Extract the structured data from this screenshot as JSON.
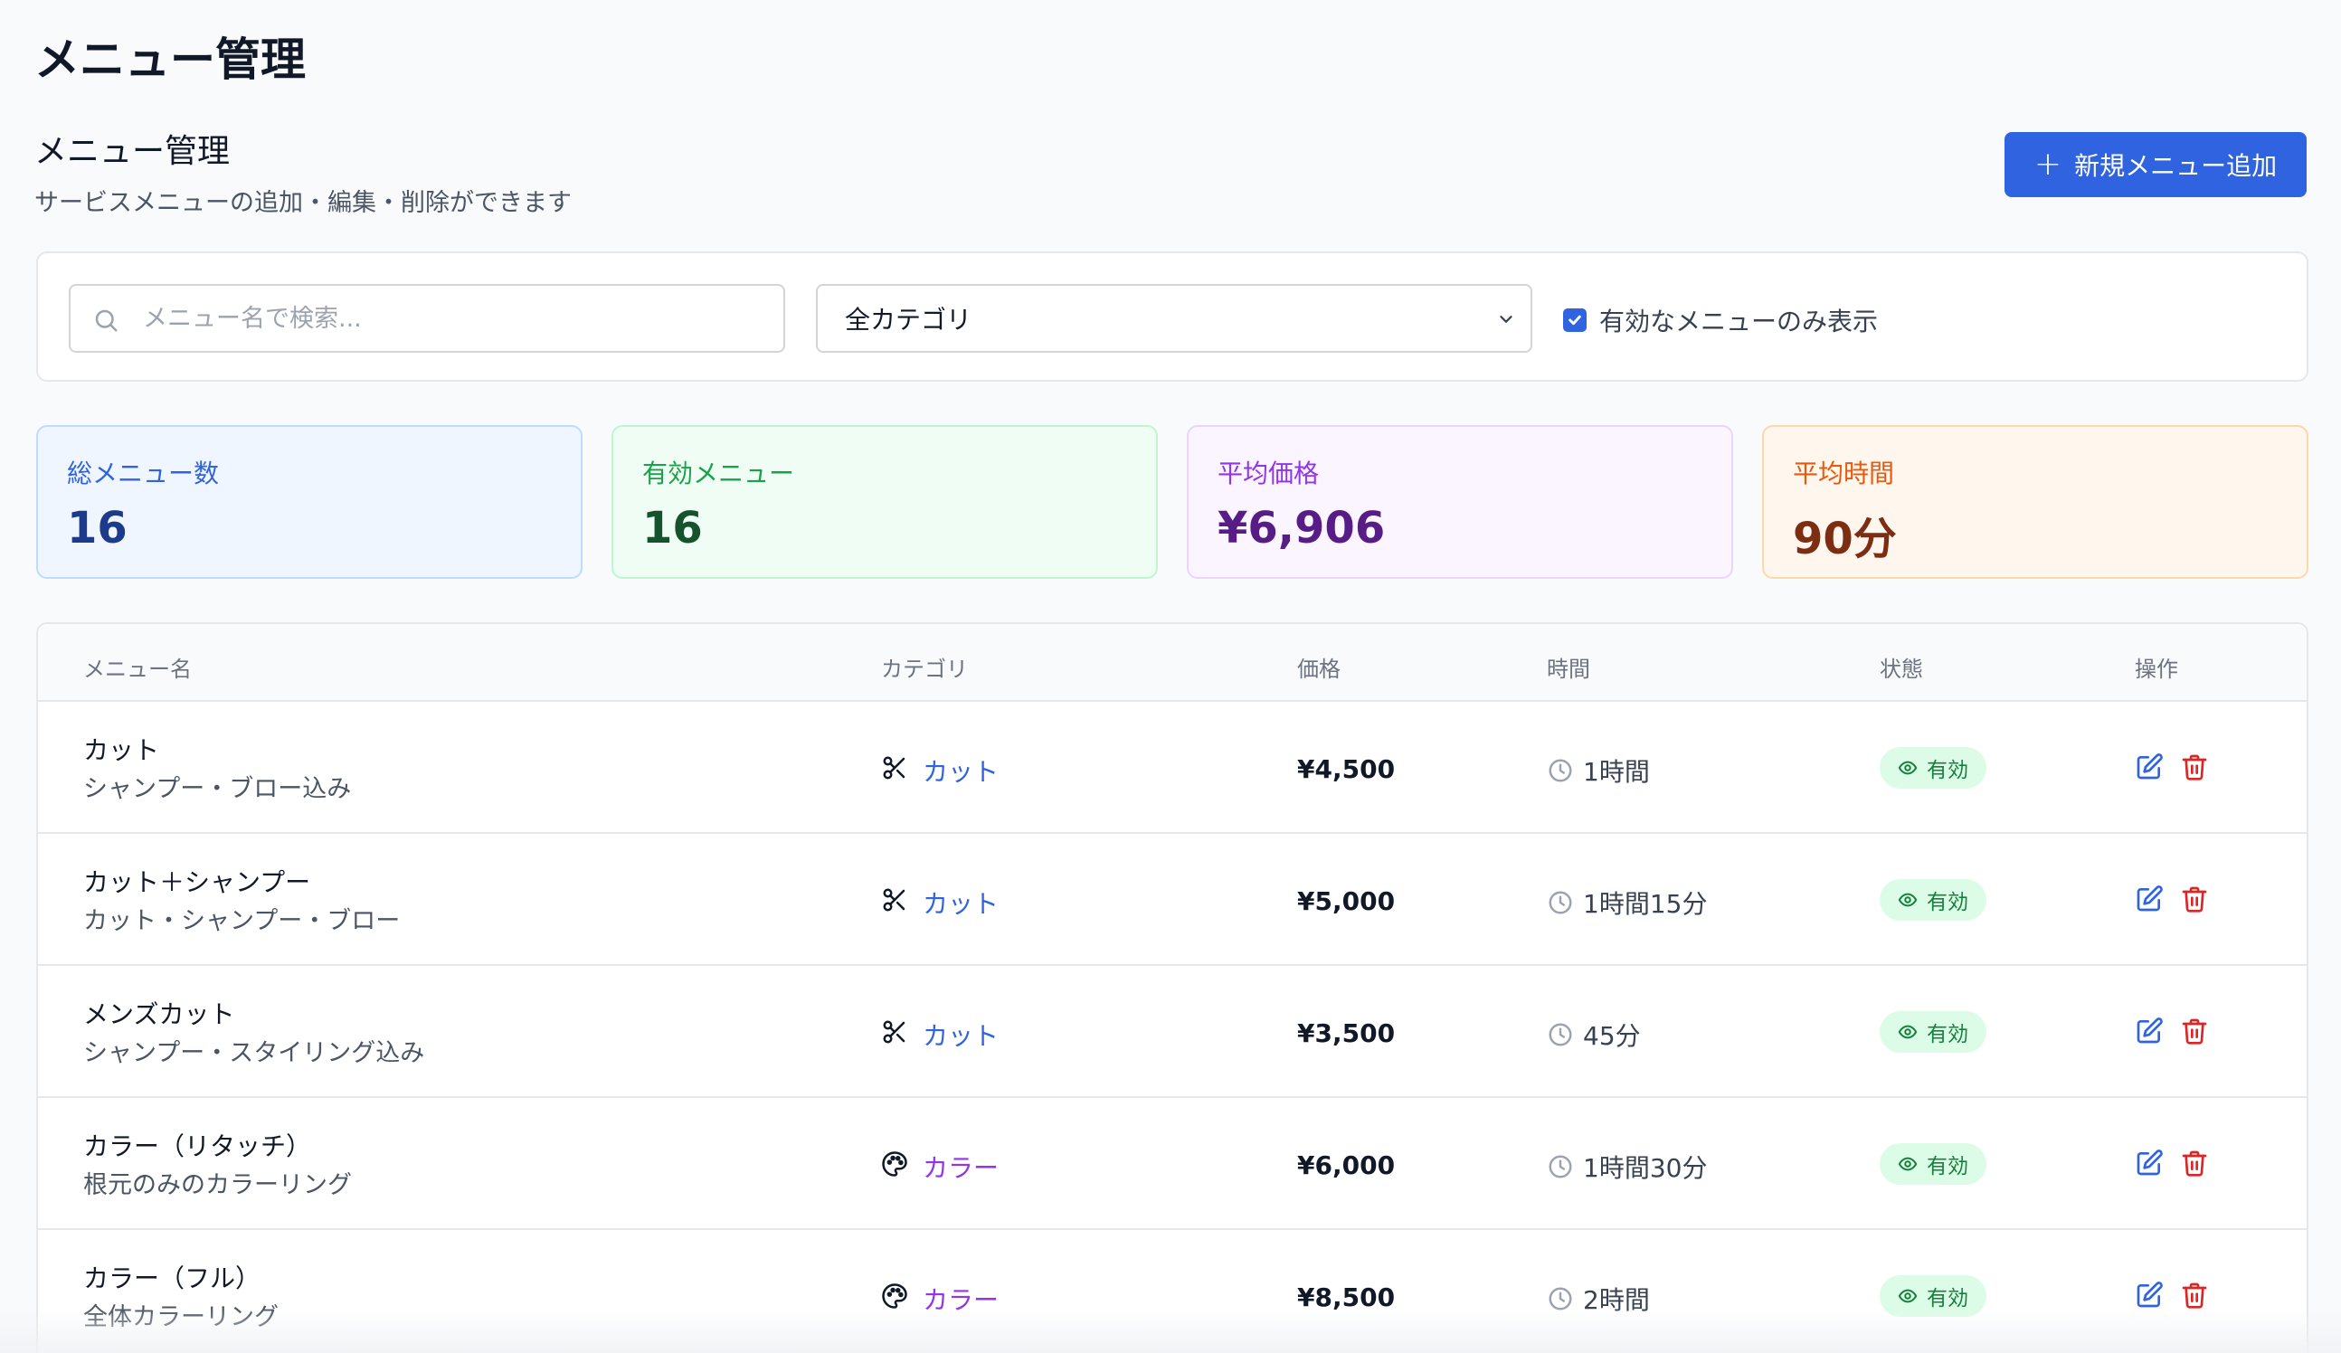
{
  "page": {
    "title": "メニュー管理"
  },
  "section": {
    "title": "メニュー管理",
    "subtitle": "サービスメニューの追加・編集・削除ができます",
    "add_button": "新規メニュー追加"
  },
  "filters": {
    "search_placeholder": "メニュー名で検索...",
    "category_selected": "全カテゴリ",
    "active_only_label": "有効なメニューのみ表示",
    "active_only_checked": true
  },
  "stats": {
    "total": {
      "label": "総メニュー数",
      "value": "16"
    },
    "active": {
      "label": "有効メニュー",
      "value": "16"
    },
    "avg_price": {
      "label": "平均価格",
      "value": "¥6,906"
    },
    "avg_time": {
      "label": "平均時間",
      "value": "90分"
    }
  },
  "table": {
    "headers": {
      "name": "メニュー名",
      "category": "カテゴリ",
      "price": "価格",
      "time": "時間",
      "status": "状態",
      "ops": "操作"
    },
    "rows": [
      {
        "name": "カット",
        "desc": "シャンプー・ブロー込み",
        "category": "カット",
        "category_icon": "scissors-icon",
        "price": "¥4,500",
        "time": "1時間",
        "status": "有効"
      },
      {
        "name": "カット＋シャンプー",
        "desc": "カット・シャンプー・ブロー",
        "category": "カット",
        "category_icon": "scissors-icon",
        "price": "¥5,000",
        "time": "1時間15分",
        "status": "有効"
      },
      {
        "name": "メンズカット",
        "desc": "シャンプー・スタイリング込み",
        "category": "カット",
        "category_icon": "scissors-icon",
        "price": "¥3,500",
        "time": "45分",
        "status": "有効"
      },
      {
        "name": "カラー（リタッチ）",
        "desc": "根元のみのカラーリング",
        "category": "カラー",
        "category_icon": "palette-icon",
        "price": "¥6,000",
        "time": "1時間30分",
        "status": "有効"
      },
      {
        "name": "カラー（フル）",
        "desc": "全体カラーリング",
        "category": "カラー",
        "category_icon": "palette-icon",
        "price": "¥8,500",
        "time": "2時間",
        "status": "有効"
      }
    ]
  },
  "colors": {
    "primary": "#2f63e0",
    "cut": "#2f63e0",
    "color": "#9333ea",
    "active_bg": "#dcfce7",
    "active_text": "#15803d",
    "delete": "#dc2626"
  }
}
